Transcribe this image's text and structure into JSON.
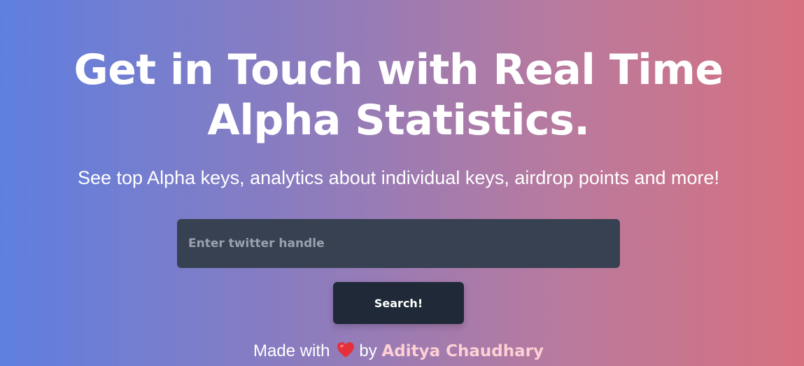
{
  "hero": {
    "title_line1": "Get in Touch with Real Time",
    "title_line2": "Alpha Statistics.",
    "subtitle": "See top Alpha keys, analytics about individual keys, airdrop points and more!"
  },
  "search": {
    "placeholder": "Enter twitter handle",
    "value": "",
    "button_label": "Search!"
  },
  "footer": {
    "made_with": "Made with",
    "heart_icon": "heart-icon",
    "by": "by",
    "author": "Aditya Chaudhary"
  },
  "colors": {
    "gradient_start": "#5f7fdf",
    "gradient_end": "#d7707f",
    "input_bg": "#374151",
    "button_bg": "#1f2937",
    "author_link": "#fcd0d4",
    "heart": "#e5303b"
  }
}
